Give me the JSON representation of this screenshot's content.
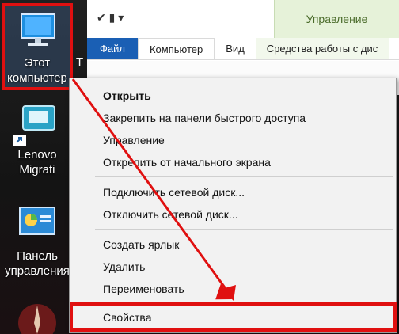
{
  "desktop": {
    "icons": [
      {
        "label": "Этот\nкомпьютер"
      },
      {
        "label": "Lenovo\nMigrati"
      },
      {
        "label": "Панель\nуправления"
      },
      {
        "label": ""
      }
    ],
    "side_letter": "T"
  },
  "explorer": {
    "quick_access": "✔ ▮ ▾",
    "manage_tab": "Управление",
    "tabs": [
      {
        "label": "Файл"
      },
      {
        "label": "Компьютер"
      },
      {
        "label": "Вид"
      },
      {
        "label": "Средства работы с дис"
      }
    ]
  },
  "context_menu": {
    "items": [
      {
        "label": "Открыть"
      },
      {
        "label": "Закрепить на панели быстрого доступа"
      },
      {
        "label": "Управление"
      },
      {
        "label": "Открепить от начального экрана"
      },
      {
        "label": "Подключить сетевой диск..."
      },
      {
        "label": "Отключить сетевой диск..."
      },
      {
        "label": "Создать ярлык"
      },
      {
        "label": "Удалить"
      },
      {
        "label": "Переименовать"
      },
      {
        "label": "Свойства"
      }
    ]
  },
  "colors": {
    "highlight": "#e01010",
    "file_tab": "#1a5fb4",
    "manage_tab": "#e6f2d9"
  }
}
